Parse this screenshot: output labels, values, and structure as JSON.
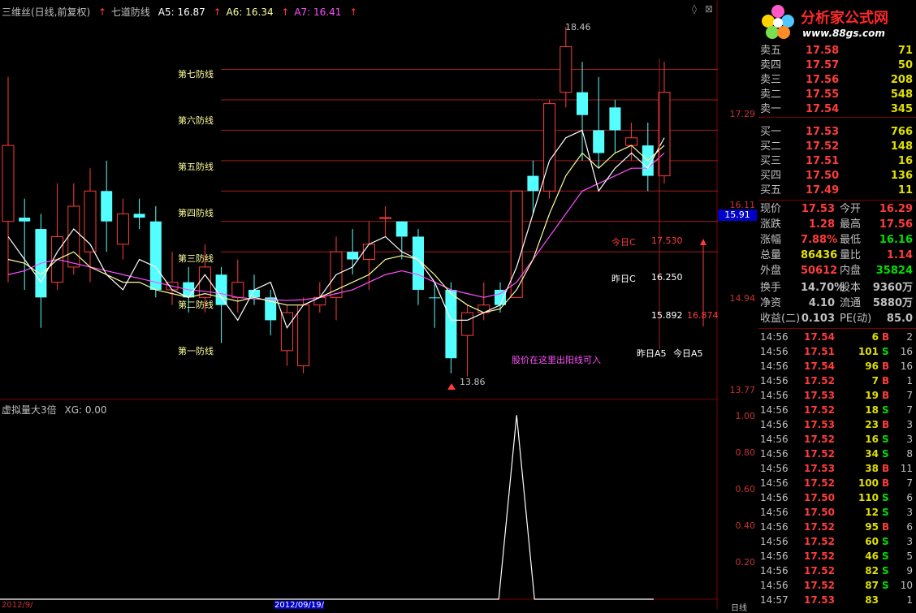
{
  "header": {
    "stock": "三维丝(日线,前复权)",
    "indicator": "七道防线",
    "a5": "A5: 16.87",
    "a6": "A6: 16.34",
    "a7": "A7: 16.41",
    "colors": {
      "a5": "#ffffff",
      "a6": "#ffff9c",
      "a7": "#ff50ff"
    }
  },
  "sub_panel": {
    "title": "虚拟量大3倍",
    "xg": "XG: 0.00"
  },
  "defense_lines": [
    "第七防线",
    "第六防线",
    "第五防线",
    "第四防线",
    "第三防线",
    "第二防线",
    "第一防线"
  ],
  "annotations": {
    "high": "18.46",
    "low": "13.86",
    "today_c_label": "今日C",
    "today_c_value": "17.530",
    "yest_c_label": "昨日C",
    "yest_c_value": "16.250",
    "a5_yest": "15.892",
    "a5_today": "16.874",
    "yest_a5": "昨日A5",
    "today_a5": "今日A5",
    "note": "股价在这里出阳线可入"
  },
  "price_axis": [
    "17.29",
    "16.11",
    "14.94",
    "13.77"
  ],
  "current_price_tag": "15.91",
  "volume_axis": [
    "1.00",
    "0.80",
    "0.60",
    "0.40",
    "0.20"
  ],
  "bottom_labels": {
    "left_date": "2012/9/",
    "mid_date": "2012/09/19/",
    "right_tab": "日线"
  },
  "logo": {
    "name": "分析家公式网",
    "url": "www.88gs.com"
  },
  "order_book": {
    "asks": [
      {
        "label": "卖五",
        "price": "17.58",
        "vol": "71"
      },
      {
        "label": "卖四",
        "price": "17.57",
        "vol": "50"
      },
      {
        "label": "卖三",
        "price": "17.56",
        "vol": "208"
      },
      {
        "label": "卖二",
        "price": "17.55",
        "vol": "548"
      },
      {
        "label": "卖一",
        "price": "17.54",
        "vol": "345"
      }
    ],
    "bids": [
      {
        "label": "买一",
        "price": "17.53",
        "vol": "766"
      },
      {
        "label": "买二",
        "price": "17.52",
        "vol": "148"
      },
      {
        "label": "买三",
        "price": "17.51",
        "vol": "16"
      },
      {
        "label": "买四",
        "price": "17.50",
        "vol": "136"
      },
      {
        "label": "买五",
        "price": "17.49",
        "vol": "11"
      }
    ]
  },
  "stats": [
    {
      "k1": "现价",
      "v1": "17.53",
      "c1": "#ff3c3c",
      "k2": "今开",
      "v2": "16.29",
      "c2": "#ff3c3c"
    },
    {
      "k1": "涨跌",
      "v1": "1.28",
      "c1": "#ff3c3c",
      "k2": "最高",
      "v2": "17.56",
      "c2": "#ff3c3c"
    },
    {
      "k1": "涨幅",
      "v1": "7.88%",
      "c1": "#ff3c3c",
      "k2": "最低",
      "v2": "16.16",
      "c2": "#00e000"
    },
    {
      "k1": "总量",
      "v1": "86436",
      "c1": "#e0e000",
      "k2": "量比",
      "v2": "1.14",
      "c2": "#ff3c3c"
    },
    {
      "k1": "外盘",
      "v1": "50612",
      "c1": "#ff3c3c",
      "k2": "内盘",
      "v2": "35824",
      "c2": "#00e000"
    },
    {
      "k1": "换手",
      "v1": "14.70%",
      "c1": "#c0c0c0",
      "k2": "股本",
      "v2": "9360万",
      "c2": "#c0c0c0"
    },
    {
      "k1": "净资",
      "v1": "4.10",
      "c1": "#c0c0c0",
      "k2": "流通",
      "v2": "5880万",
      "c2": "#c0c0c0"
    },
    {
      "k1": "收益(二)",
      "v1": "0.103",
      "c1": "#c0c0c0",
      "k2": "PE(动)",
      "v2": "85.0",
      "c2": "#c0c0c0"
    }
  ],
  "ticks": [
    {
      "t": "14:56",
      "p": "17.54",
      "v": "6",
      "bs": "B",
      "n": "2"
    },
    {
      "t": "14:56",
      "p": "17.51",
      "v": "101",
      "bs": "S",
      "n": "16"
    },
    {
      "t": "14:56",
      "p": "17.54",
      "v": "96",
      "bs": "B",
      "n": "16"
    },
    {
      "t": "14:56",
      "p": "17.52",
      "v": "7",
      "bs": "B",
      "n": "1"
    },
    {
      "t": "14:56",
      "p": "17.53",
      "v": "19",
      "bs": "B",
      "n": "7"
    },
    {
      "t": "14:56",
      "p": "17.52",
      "v": "18",
      "bs": "S",
      "n": "7"
    },
    {
      "t": "14:56",
      "p": "17.53",
      "v": "23",
      "bs": "B",
      "n": "3"
    },
    {
      "t": "14:56",
      "p": "17.52",
      "v": "16",
      "bs": "S",
      "n": "3"
    },
    {
      "t": "14:56",
      "p": "17.52",
      "v": "34",
      "bs": "S",
      "n": "8"
    },
    {
      "t": "14:56",
      "p": "17.53",
      "v": "38",
      "bs": "B",
      "n": "11"
    },
    {
      "t": "14:56",
      "p": "17.52",
      "v": "100",
      "bs": "B",
      "n": "7"
    },
    {
      "t": "14:56",
      "p": "17.50",
      "v": "110",
      "bs": "S",
      "n": "6"
    },
    {
      "t": "14:56",
      "p": "17.50",
      "v": "12",
      "bs": "S",
      "n": "3"
    },
    {
      "t": "14:56",
      "p": "17.52",
      "v": "95",
      "bs": "B",
      "n": "6"
    },
    {
      "t": "14:56",
      "p": "17.52",
      "v": "60",
      "bs": "S",
      "n": "3"
    },
    {
      "t": "14:56",
      "p": "17.52",
      "v": "46",
      "bs": "S",
      "n": "5"
    },
    {
      "t": "14:56",
      "p": "17.52",
      "v": "82",
      "bs": "S",
      "n": "9"
    },
    {
      "t": "14:56",
      "p": "17.52",
      "v": "87",
      "bs": "S",
      "n": "10"
    },
    {
      "t": "14:57",
      "p": "17.53",
      "v": "83",
      "bs": "",
      "n": "1"
    }
  ],
  "chart_data": {
    "type": "candlestick",
    "price_range": [
      13.6,
      18.6
    ],
    "candles": [
      {
        "o": 15.9,
        "c": 16.9,
        "h": 17.8,
        "l": 15.1,
        "up": true
      },
      {
        "o": 15.95,
        "c": 15.9,
        "h": 16.2,
        "l": 15.0,
        "up": false
      },
      {
        "o": 15.8,
        "c": 14.9,
        "h": 16.0,
        "l": 14.5,
        "up": false
      },
      {
        "o": 15.1,
        "c": 15.7,
        "h": 16.4,
        "l": 15.0,
        "up": true
      },
      {
        "o": 15.3,
        "c": 16.1,
        "h": 16.4,
        "l": 15.2,
        "up": true
      },
      {
        "o": 15.5,
        "c": 16.3,
        "h": 16.6,
        "l": 15.1,
        "up": true
      },
      {
        "o": 16.3,
        "c": 15.9,
        "h": 16.7,
        "l": 15.5,
        "up": false
      },
      {
        "o": 15.6,
        "c": 16.0,
        "h": 16.2,
        "l": 15.4,
        "up": true
      },
      {
        "o": 16.0,
        "c": 15.95,
        "h": 16.2,
        "l": 15.8,
        "up": false
      },
      {
        "o": 15.9,
        "c": 15.0,
        "h": 16.1,
        "l": 14.9,
        "up": false
      },
      {
        "o": 15.0,
        "c": 15.1,
        "h": 15.5,
        "l": 14.8,
        "up": true
      },
      {
        "o": 15.1,
        "c": 14.9,
        "h": 15.3,
        "l": 14.7,
        "up": false
      },
      {
        "o": 14.9,
        "c": 15.3,
        "h": 15.6,
        "l": 14.7,
        "up": true
      },
      {
        "o": 15.2,
        "c": 14.8,
        "h": 15.3,
        "l": 14.3,
        "up": false
      },
      {
        "o": 14.9,
        "c": 15.1,
        "h": 15.4,
        "l": 14.7,
        "up": true
      },
      {
        "o": 15.0,
        "c": 14.9,
        "h": 15.2,
        "l": 14.8,
        "up": false
      },
      {
        "o": 14.9,
        "c": 14.6,
        "h": 15.0,
        "l": 14.4,
        "up": false
      },
      {
        "o": 14.2,
        "c": 14.7,
        "h": 14.8,
        "l": 14.0,
        "up": true
      },
      {
        "o": 14.0,
        "c": 14.8,
        "h": 14.9,
        "l": 13.9,
        "up": true
      },
      {
        "o": 14.8,
        "c": 14.9,
        "h": 15.1,
        "l": 14.7,
        "up": true
      },
      {
        "o": 14.9,
        "c": 15.5,
        "h": 15.7,
        "l": 14.6,
        "up": true
      },
      {
        "o": 15.5,
        "c": 15.4,
        "h": 15.8,
        "l": 15.2,
        "up": false
      },
      {
        "o": 15.4,
        "c": 15.6,
        "h": 15.9,
        "l": 15.0,
        "up": true
      },
      {
        "o": 15.95,
        "c": 15.95,
        "h": 16.1,
        "l": 15.7,
        "up": true
      },
      {
        "o": 15.9,
        "c": 15.7,
        "h": 15.9,
        "l": 15.4,
        "up": false
      },
      {
        "o": 15.7,
        "c": 15.0,
        "h": 15.8,
        "l": 14.8,
        "up": false
      },
      {
        "o": 14.9,
        "c": 14.9,
        "h": 15.1,
        "l": 14.5,
        "up": false
      },
      {
        "o": 15.0,
        "c": 14.1,
        "h": 15.1,
        "l": 13.9,
        "up": false
      },
      {
        "o": 14.4,
        "c": 14.7,
        "h": 14.8,
        "l": 13.86,
        "up": true
      },
      {
        "o": 14.7,
        "c": 14.8,
        "h": 15.1,
        "l": 14.6,
        "up": true
      },
      {
        "o": 14.8,
        "c": 15.0,
        "h": 15.1,
        "l": 14.7,
        "up": false
      },
      {
        "o": 14.9,
        "c": 16.3,
        "h": 16.3,
        "l": 14.9,
        "up": true
      },
      {
        "o": 16.3,
        "c": 16.5,
        "h": 16.7,
        "l": 16.0,
        "up": false
      },
      {
        "o": 16.3,
        "c": 17.45,
        "h": 17.5,
        "l": 16.2,
        "up": true
      },
      {
        "o": 17.6,
        "c": 18.2,
        "h": 18.46,
        "l": 17.4,
        "up": true
      },
      {
        "o": 17.6,
        "c": 17.3,
        "h": 18.0,
        "l": 16.7,
        "up": false
      },
      {
        "o": 17.1,
        "c": 16.8,
        "h": 17.8,
        "l": 16.6,
        "up": false
      },
      {
        "o": 17.4,
        "c": 17.1,
        "h": 17.5,
        "l": 16.8,
        "up": false
      },
      {
        "o": 16.9,
        "c": 17.0,
        "h": 17.2,
        "l": 16.7,
        "up": true
      },
      {
        "o": 16.9,
        "c": 16.5,
        "h": 17.2,
        "l": 16.3,
        "up": false
      },
      {
        "o": 16.5,
        "c": 17.6,
        "h": 18.0,
        "l": 16.4,
        "up": true
      }
    ],
    "ma_a5": [
      15.7,
      15.4,
      15.1,
      15.5,
      15.8,
      15.6,
      15.2,
      15.0,
      15.4,
      15.3,
      15.0,
      14.9,
      15.2,
      14.9,
      14.6,
      15.0,
      15.1,
      14.5,
      14.8,
      14.9,
      15.2,
      15.3,
      15.6,
      15.7,
      15.5,
      15.4,
      15.1,
      14.6,
      14.6,
      14.7,
      14.8,
      15.3,
      16.0,
      16.7,
      17.0,
      17.1,
      16.3,
      16.6,
      16.8,
      16.6,
      17.0
    ],
    "ma_a6": [
      15.4,
      15.35,
      15.2,
      15.4,
      15.5,
      15.3,
      15.2,
      15.1,
      15.1,
      15.0,
      14.95,
      14.9,
      14.95,
      14.9,
      14.85,
      14.9,
      14.85,
      14.8,
      14.8,
      14.9,
      15.0,
      15.1,
      15.2,
      15.4,
      15.45,
      15.4,
      15.2,
      14.95,
      14.8,
      14.7,
      14.75,
      15.0,
      15.4,
      16.0,
      16.5,
      16.8,
      16.6,
      16.8,
      16.9,
      16.7,
      16.9
    ],
    "ma_a7": [
      15.2,
      15.25,
      15.35,
      15.4,
      15.35,
      15.3,
      15.25,
      15.2,
      15.15,
      15.1,
      15.05,
      15.0,
      14.98,
      14.95,
      14.9,
      14.88,
      14.87,
      14.86,
      14.87,
      14.9,
      14.95,
      15.0,
      15.1,
      15.2,
      15.25,
      15.2,
      15.1,
      15.0,
      14.95,
      14.9,
      14.95,
      15.1,
      15.4,
      15.7,
      16.0,
      16.3,
      16.4,
      16.5,
      16.6,
      16.6,
      16.8
    ],
    "defense_levels": [
      17.9,
      17.5,
      17.1,
      16.7,
      16.3,
      15.9,
      15.5
    ],
    "volume_signal": {
      "peak_index": 31,
      "value": 1.0
    },
    "volume_range": [
      0,
      1.05
    ]
  }
}
